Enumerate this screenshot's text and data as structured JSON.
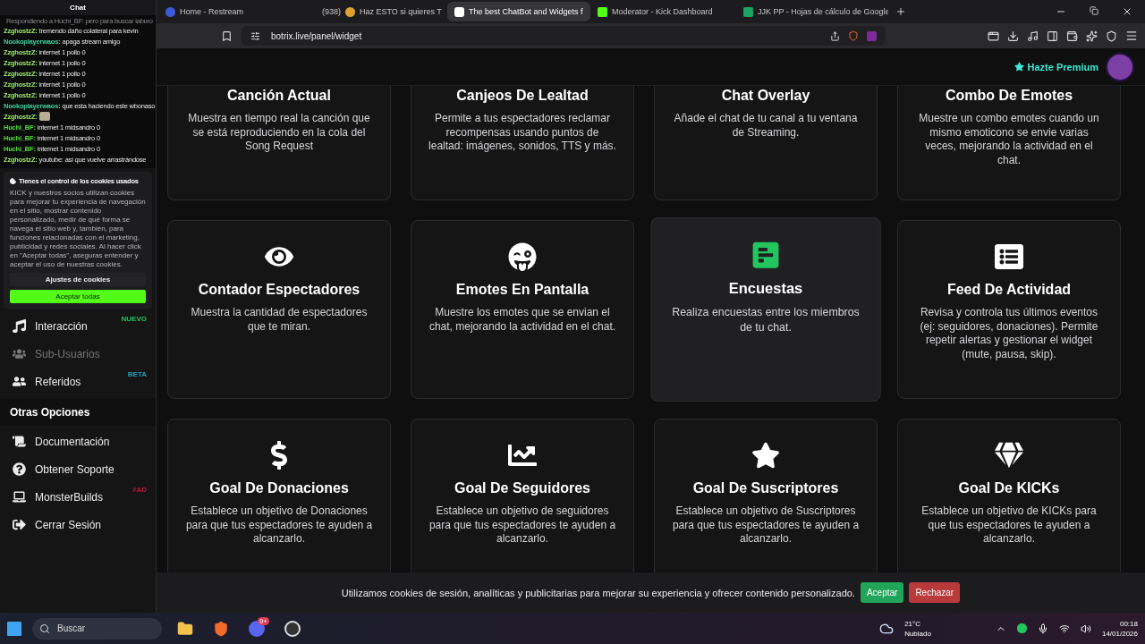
{
  "chat": {
    "title": "Chat",
    "reply": "Respondiendo a Huchi_BF: pero para buscar laburo",
    "messages": [
      {
        "user": "ZzghostzZ:",
        "color": "#9be86a",
        "text": "tremendo daño colateral para kevin",
        "kind": "text"
      },
      {
        "user": "Nookoplayerwaos:",
        "color": "#3fcf9f",
        "text": "apaga stream amigo",
        "kind": "text"
      },
      {
        "user": "ZzghostzZ:",
        "color": "#9be86a",
        "text": "internet 1 pollo 0",
        "kind": "text"
      },
      {
        "user": "ZzghostzZ:",
        "color": "#9be86a",
        "text": "internet 1 pollo 0",
        "kind": "text"
      },
      {
        "user": "ZzghostzZ:",
        "color": "#9be86a",
        "text": "internet 1 pollo 0",
        "kind": "text"
      },
      {
        "user": "ZzghostzZ:",
        "color": "#9be86a",
        "text": "internet 1 pollo 0",
        "kind": "text"
      },
      {
        "user": "ZzghostzZ:",
        "color": "#9be86a",
        "text": "internet 1 pollo 0",
        "kind": "text"
      },
      {
        "user": "Nookoplayerwaos:",
        "color": "#3fcf9f",
        "text": "que esta haciendo este wbonaso",
        "kind": "text"
      },
      {
        "user": "ZzghostzZ:",
        "color": "#9be86a",
        "kind": "emote"
      },
      {
        "user": "Huchi_BF:",
        "color": "#55dd3c",
        "text": "internet 1 midsandro 0",
        "kind": "text"
      },
      {
        "user": "Huchi_BF:",
        "color": "#55dd3c",
        "text": "internet 1 midsandro 0",
        "kind": "text"
      },
      {
        "user": "Huchi_BF:",
        "color": "#55dd3c",
        "text": "internet 1 midsandro 0",
        "kind": "text"
      },
      {
        "user": "ZzghostzZ:",
        "color": "#9be86a",
        "text": "youtube: asi que vuelve arrastrándose",
        "kind": "text"
      }
    ]
  },
  "cookie_popup": {
    "title": "Tienes el control de los cookies usados",
    "body": "KICK y nuestros socios utilizan cookies para mejorar tu experiencia de navegación en el sitio, mostrar contenido personalizado, medir de qué forma se navega el sitio web y, también, para funciones relacionadas con el marketing, publicidad y redes sociales. Al hacer click en \"Aceptar todas\", aseguras entender y aceptar el uso de nuestras cookies.",
    "settings_button": "Ajustes de cookies",
    "accept_button": "Aceptar todas"
  },
  "sidebar": {
    "items": [
      {
        "label": "Interacción",
        "disabled": false,
        "badge": {
          "text": "NUEVO",
          "color": "#22c55e"
        }
      },
      {
        "label": "Sub-Usuarios",
        "disabled": true
      },
      {
        "label": "Referidos",
        "disabled": false,
        "badge": {
          "text": "BETA",
          "color": "#1fa2b8"
        }
      }
    ],
    "section": "Otras Opciones",
    "other_items": [
      {
        "label": "Documentación",
        "disabled": false
      },
      {
        "label": "Obtener Soporte",
        "disabled": false
      },
      {
        "label": "MonsterBuilds",
        "disabled": false,
        "badge": {
          "text": "#AD",
          "color": "#b4123c"
        }
      },
      {
        "label": "Cerrar Sesión",
        "disabled": false
      }
    ]
  },
  "browser": {
    "tabs": [
      {
        "label": "Home - Restream",
        "selected": false,
        "audio": false
      },
      {
        "count": "(938)",
        "label": "Haz ESTO si quieres T",
        "selected": false,
        "audio": true
      },
      {
        "label": "The best ChatBot and Widgets f",
        "selected": true,
        "audio": false
      },
      {
        "label": "Moderator - Kick Dashboard",
        "selected": false,
        "audio": false
      },
      {
        "label": "JJK PP - Hojas de cálculo de Google",
        "selected": false,
        "audio": false
      }
    ],
    "address": "botrix.live/panel/widget"
  },
  "header": {
    "premium": "Hazte Premium"
  },
  "widgets": [
    {
      "title": "Canción Actual",
      "description": "Muestra en tiempo real la canción que se está reproduciendo en la cola del Song Request",
      "highlighted": false
    },
    {
      "title": "Canjeos De Lealtad",
      "description": "Permite a tus espectadores reclamar recompensas usando puntos de lealtad: imágenes, sonidos, TTS y más.",
      "highlighted": false
    },
    {
      "title": "Chat Overlay",
      "description": "Añade el chat de tu canal a tu ventana de Streaming.",
      "highlighted": false
    },
    {
      "title": "Combo De Emotes",
      "description": "Muestre un combo emotes cuando un mismo emoticono se envie varias veces, mejorando la actividad en el chat.",
      "highlighted": false
    },
    {
      "title": "Contador Espectadores",
      "description": "Muestra la cantidad de espectadores que te miran.",
      "highlighted": false
    },
    {
      "title": "Emotes En Pantalla",
      "description": "Muestre los emotes que se envian el chat, mejorando la actividad en el chat.",
      "highlighted": false
    },
    {
      "title": "Encuestas",
      "description": "Realiza encuestas entre los miembros de tu chat.",
      "highlighted": true
    },
    {
      "title": "Feed De Actividad",
      "description": "Revisa y controla tus últimos eventos (ej: seguidores, donaciones). Permite repetir alertas y gestionar el widget (mute, pausa, skip).",
      "highlighted": false
    },
    {
      "title": "Goal De Donaciones",
      "description": "Establece un objetivo de Donaciones para que tus espectadores te ayuden a alcanzarlo.",
      "highlighted": false
    },
    {
      "title": "Goal De Seguidores",
      "description": "Establece un objetivo de seguidores para que tus espectadores te ayuden a alcanzarlo.",
      "highlighted": false
    },
    {
      "title": "Goal De Suscriptores",
      "description": "Establece un objetivo de Suscriptores para que tus espectadores te ayuden a alcanzarlo.",
      "highlighted": false
    },
    {
      "title": "Goal De KICKs",
      "description": "Establece un objetivo de KICKs para que tus espectadores te ayuden a alcanzarlo.",
      "highlighted": false
    }
  ],
  "cookie_banner": {
    "text": "Utilizamos cookies de sesión, analíticas y publicitarias para mejorar su experiencia y ofrecer contenido personalizado.",
    "accept": "Aceptar",
    "reject": "Rechazar"
  },
  "taskbar": {
    "search": "Buscar",
    "discord_badge": "9+",
    "temperature": "21°C",
    "weather": "Nublado",
    "time": "00:18",
    "date": "14/01/2026"
  }
}
